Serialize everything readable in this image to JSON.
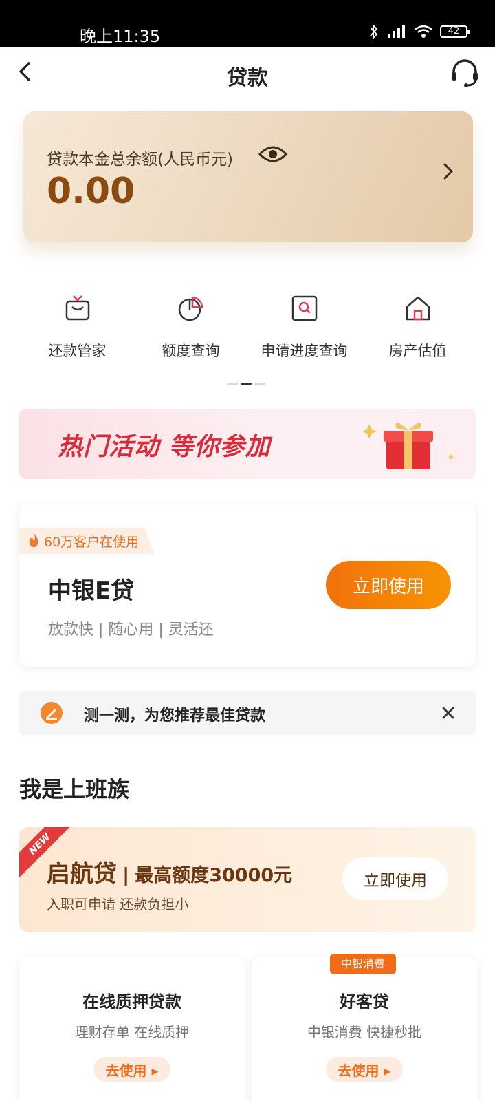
{
  "status_bar": {
    "time": "晚上11:35",
    "battery": "42"
  },
  "header": {
    "title": "贷款"
  },
  "balance_card": {
    "label": "贷款本金总余额(人民币元)",
    "amount": "0.00"
  },
  "quick_actions": [
    {
      "label": "还款管家",
      "icon": "gift-bag-icon"
    },
    {
      "label": "额度查询",
      "icon": "pie-chart-icon"
    },
    {
      "label": "申请进度查询",
      "icon": "search-box-icon"
    },
    {
      "label": "房产估值",
      "icon": "house-icon"
    }
  ],
  "banner": {
    "text": "热门活动 等你参加"
  },
  "featured_product": {
    "users_tag": "60万客户在使用",
    "name": "中银E贷",
    "desc": "放款快 | 随心用 | 灵活还",
    "button": "立即使用"
  },
  "tip": {
    "text": "测一测，为您推荐最佳贷款"
  },
  "section": {
    "title": "我是上班族"
  },
  "promo": {
    "ribbon": "NEW",
    "name": "启航贷",
    "separator": "|",
    "limit": "最高额度30000元",
    "subtitle": "入职可申请 还款负担小",
    "button": "立即使用"
  },
  "tiles": [
    {
      "title": "在线质押贷款",
      "desc": "理财存单 在线质押",
      "button": "去使用 ▸",
      "tag": ""
    },
    {
      "title": "好客贷",
      "desc": "中银消费 快捷秒批",
      "button": "去使用 ▸",
      "tag": "中银消费"
    }
  ],
  "colors": {
    "accent": "#f2720d",
    "brown": "#8b4a10",
    "banner_red": "#d92b3a"
  }
}
